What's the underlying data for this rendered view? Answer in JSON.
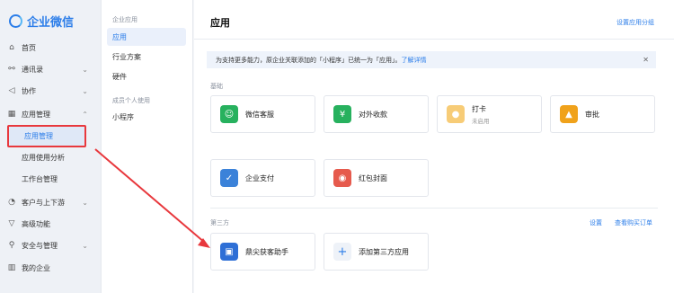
{
  "sidebar": {
    "brand": "企业微信",
    "items": [
      {
        "label": "首页",
        "icon": "home-icon"
      },
      {
        "label": "通讯录",
        "icon": "org-icon"
      },
      {
        "label": "协作",
        "icon": "send-icon"
      },
      {
        "label": "应用管理",
        "icon": "grid-icon"
      },
      {
        "label": "客户与上下游",
        "icon": "customer-icon"
      },
      {
        "label": "高级功能",
        "icon": "diamond-icon"
      },
      {
        "label": "安全与管理",
        "icon": "shield-icon"
      },
      {
        "label": "我的企业",
        "icon": "building-icon"
      }
    ],
    "subitems": [
      "应用管理",
      "应用使用分析",
      "工作台管理"
    ]
  },
  "midcol": {
    "section1": "企业应用",
    "items1": [
      "应用",
      "行业方案",
      "硬件"
    ],
    "section2": "成员个人使用",
    "items2": [
      "小程序"
    ]
  },
  "main": {
    "title": "应用",
    "settings_link": "设置应用分组",
    "notice_text": "为支持更多能力，原企业关联添加的「小程序」已统一为「应用」。",
    "notice_link": "了解详情",
    "basic_label": "基础",
    "third_label": "第三方",
    "third_settings": "设置",
    "third_purchase": "查看购买订单",
    "basic_apps": [
      {
        "name": "微信客服",
        "sub": "",
        "color": "#27b15e",
        "icon": "chat-icon",
        "glyph": "☺"
      },
      {
        "name": "对外收款",
        "sub": "",
        "color": "#27b15e",
        "icon": "yen-icon",
        "glyph": "¥"
      },
      {
        "name": "打卡",
        "sub": "未启用",
        "color": "#f7cc77",
        "icon": "location-icon",
        "glyph": "●"
      },
      {
        "name": "审批",
        "sub": "",
        "color": "#f0a21b",
        "icon": "stamp-icon",
        "glyph": "▲"
      },
      {
        "name": "企业支付",
        "sub": "",
        "color": "#3b82d9",
        "icon": "pay-icon",
        "glyph": "✓"
      },
      {
        "name": "红包封面",
        "sub": "",
        "color": "#e65a4d",
        "icon": "redpacket-icon",
        "glyph": "◉"
      }
    ],
    "third_apps": [
      {
        "name": "鼎尖获客助手",
        "color": "#2e6fd6",
        "icon": "assistant-icon"
      }
    ],
    "add_third": "添加第三方应用"
  }
}
